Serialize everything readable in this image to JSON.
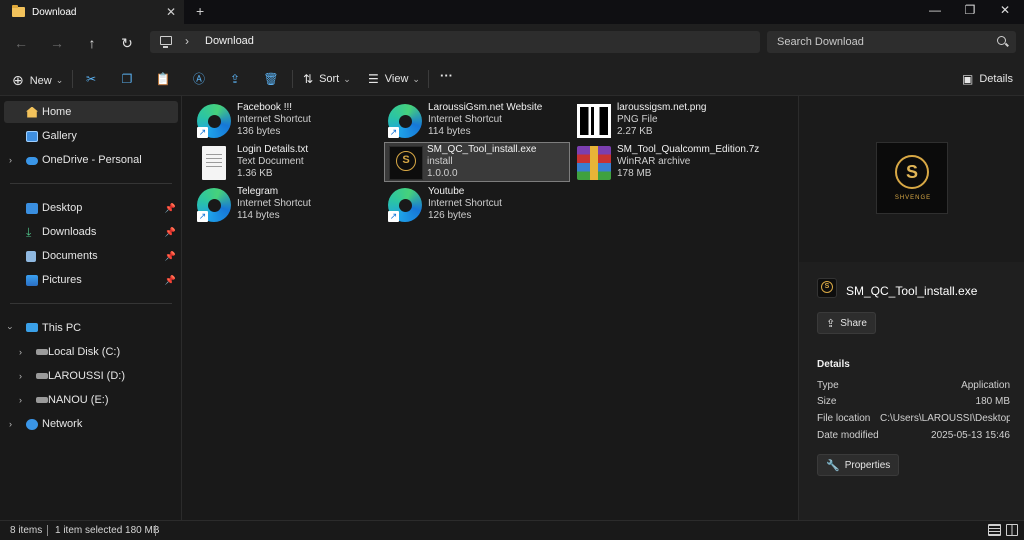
{
  "window": {
    "tab_title": "Download",
    "tab_close": "✕",
    "new_tab": "+",
    "minimize": "—",
    "maximize": "❐",
    "close": "✕"
  },
  "nav": {
    "back": "←",
    "forward": "→",
    "up": "↑",
    "refresh": "↻",
    "chevron": "›",
    "address": "Download",
    "search_placeholder": "Search Download"
  },
  "commands": {
    "new": "New",
    "sort": "Sort",
    "view": "View",
    "more": "···",
    "details": "Details",
    "caret": "⌄"
  },
  "sidebar": {
    "items": [
      {
        "label": "Home"
      },
      {
        "label": "Gallery"
      },
      {
        "label": "OneDrive - Personal"
      },
      {
        "label": "Desktop"
      },
      {
        "label": "Downloads"
      },
      {
        "label": "Documents"
      },
      {
        "label": "Pictures"
      },
      {
        "label": "This PC"
      },
      {
        "label": "Local Disk (C:)"
      },
      {
        "label": "LAROUSSI (D:)"
      },
      {
        "label": "NANOU (E:)"
      },
      {
        "label": "Network"
      }
    ]
  },
  "files": [
    {
      "name": "Facebook !!!",
      "type": "Internet Shortcut",
      "size": "136 bytes"
    },
    {
      "name": "LaroussiGsm.net Website",
      "type": "Internet Shortcut",
      "size": "114 bytes"
    },
    {
      "name": "laroussigsm.net.png",
      "type": "PNG File",
      "size": "2.27 KB"
    },
    {
      "name": "Login Details.txt",
      "type": "Text Document",
      "size": "1.36 KB"
    },
    {
      "name": "SM_QC_Tool_install.exe",
      "type": "install",
      "size": "1.0.0.0"
    },
    {
      "name": "SM_Tool_Qualcomm_Edition.7z",
      "type": "WinRAR archive",
      "size": "178 MB"
    },
    {
      "name": "Telegram",
      "type": "Internet Shortcut",
      "size": "114 bytes"
    },
    {
      "name": "Youtube",
      "type": "Internet Shortcut",
      "size": "126 bytes"
    }
  ],
  "details": {
    "file_name": "SM_QC_Tool_install.exe",
    "share": "Share",
    "heading": "Details",
    "props": [
      {
        "key": "Type",
        "value": "Application"
      },
      {
        "key": "Size",
        "value": "180 MB"
      },
      {
        "key": "File location",
        "value": "C:\\Users\\LAROUSSI\\Desktop\\..."
      },
      {
        "key": "Date modified",
        "value": "2025-05-13 15:46"
      }
    ],
    "properties": "Properties"
  },
  "status": {
    "count": "8 items",
    "selection": "1 item selected  180 MB"
  },
  "colors": {
    "accent": "#5ab0f0",
    "folder": "#f2c25b",
    "brand_gold": "#d8a845"
  }
}
